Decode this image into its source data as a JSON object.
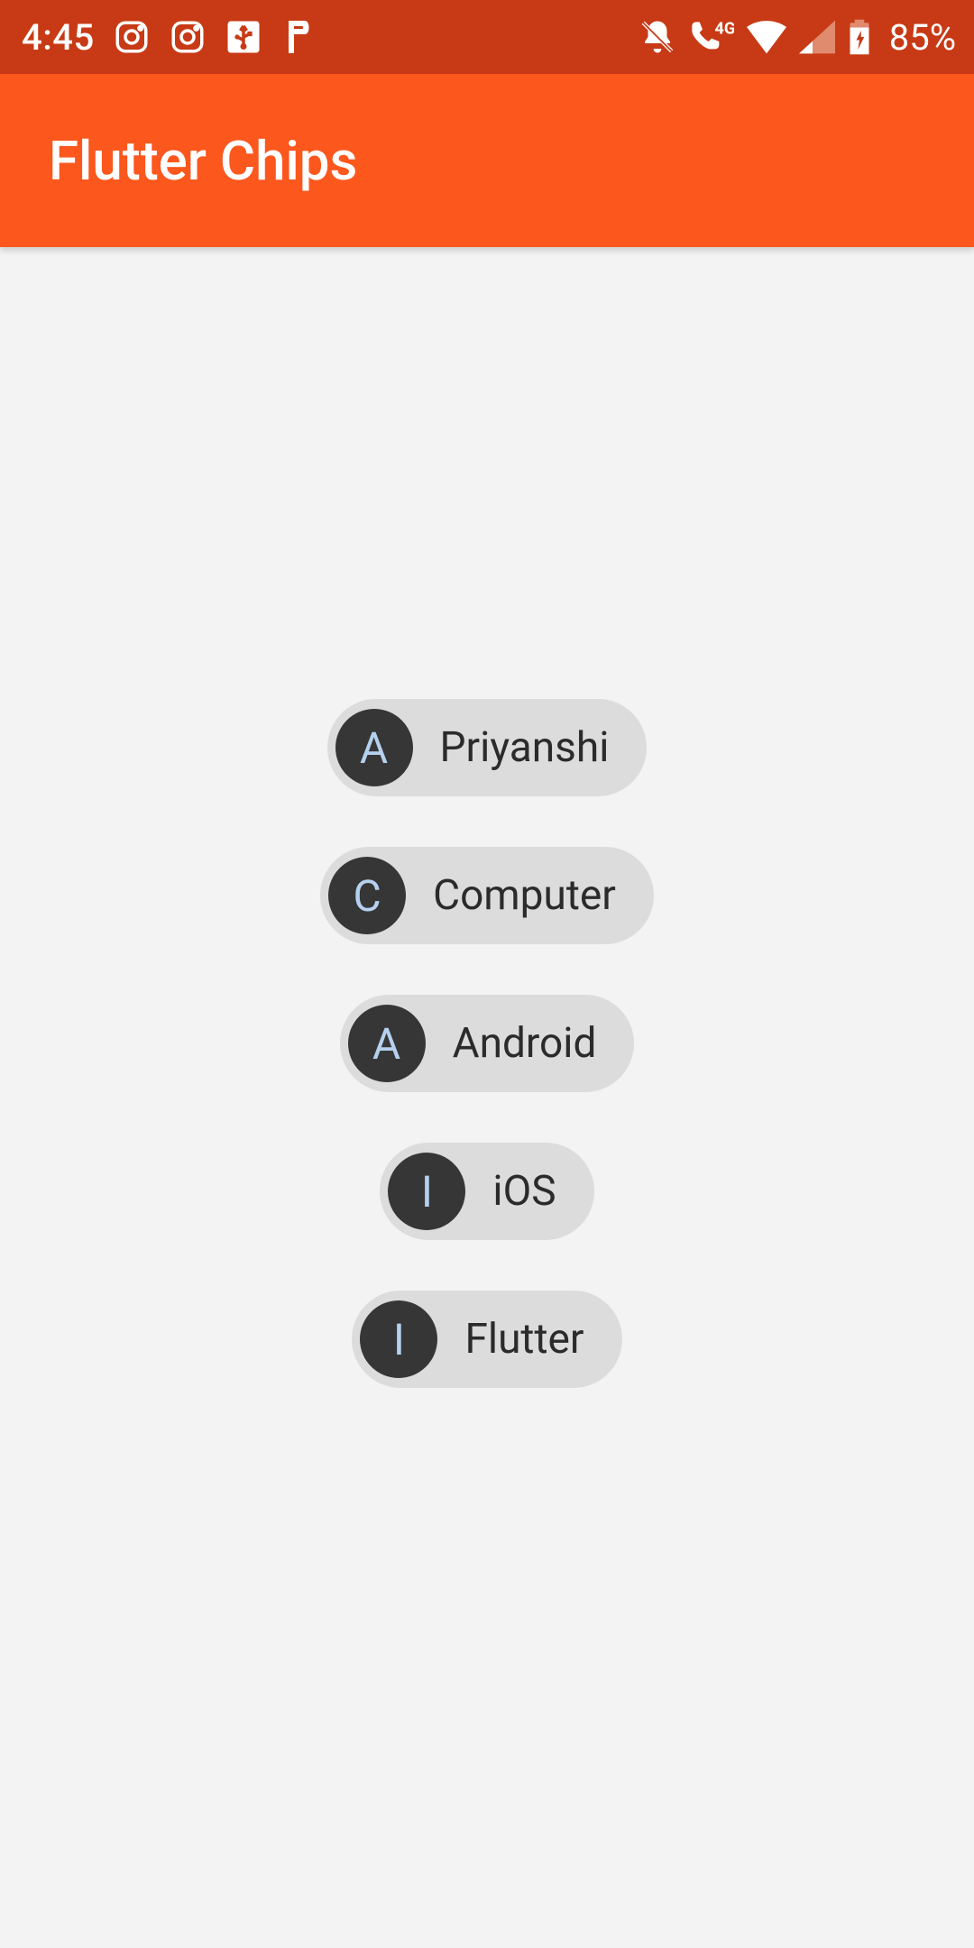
{
  "status": {
    "time": "4:45",
    "battery": "85%"
  },
  "appbar": {
    "title": "Flutter Chips"
  },
  "chips": [
    {
      "avatar": "A",
      "label": "Priyanshi"
    },
    {
      "avatar": "C",
      "label": "Computer"
    },
    {
      "avatar": "A",
      "label": "Android"
    },
    {
      "avatar": "I",
      "label": "iOS"
    },
    {
      "avatar": "I",
      "label": "Flutter"
    }
  ]
}
